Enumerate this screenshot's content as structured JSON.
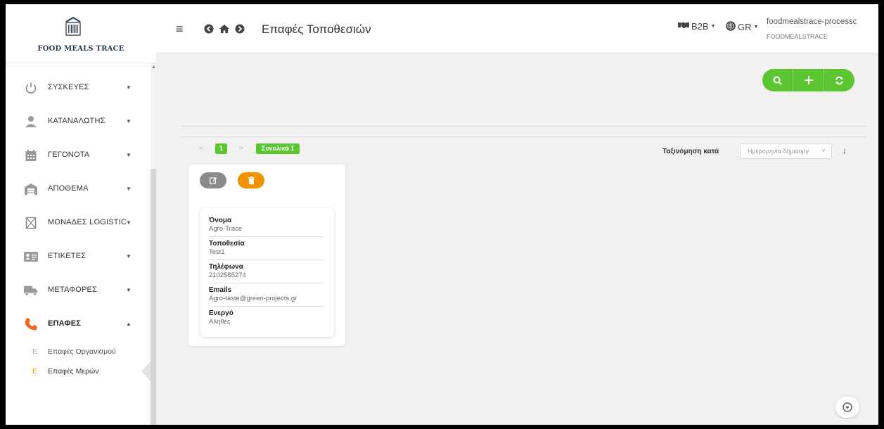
{
  "brand": {
    "name": "FOOD MEALS TRACE"
  },
  "header": {
    "page_title": "Επαφές Τοποθεσιών",
    "b2b_label": "B2B",
    "lang_label": "GR",
    "user_name": "foodmealstrace-processc",
    "user_org": "FOODMEALSTRACE"
  },
  "sidebar": {
    "items": [
      {
        "label": "ΣΥΣΚΕΥΕΣ",
        "icon": "power-icon"
      },
      {
        "label": "ΚΑΤΑΝΑΛΩΤΗΣ",
        "icon": "user-icon"
      },
      {
        "label": "ΓΕΓΟΝΟΤΑ",
        "icon": "calendar-icon"
      },
      {
        "label": "ΑΠΟΘΕΜΑ",
        "icon": "warehouse-icon"
      },
      {
        "label": "ΜΟΝΑΔΕΣ LOGISTIC",
        "icon": "box-icon"
      },
      {
        "label": "ΕΤΙΚΕΤΕΣ",
        "icon": "label-icon"
      },
      {
        "label": "ΜΕΤΑΦΟΡΕΣ",
        "icon": "truck-icon"
      },
      {
        "label": "ΕΠΑΦΕΣ",
        "icon": "phone-icon"
      }
    ],
    "subitems": [
      {
        "letter": "E",
        "label": "Επαφές Οργανισμού"
      },
      {
        "letter": "E",
        "label": "Επαφές Μερών"
      }
    ]
  },
  "pagination": {
    "current_page": "1",
    "total_label": "Συνολικά 1"
  },
  "sort": {
    "label": "Ταξινόμηση κατά",
    "selected": "Ημερομηνία δημιουργ"
  },
  "card": {
    "fields": [
      {
        "label": "Όνομα",
        "value": "Agro-Trace"
      },
      {
        "label": "Τοποθεσία",
        "value": "Test1"
      },
      {
        "label": "Τηλέφωνα",
        "value": "2102585274"
      },
      {
        "label": "Emails",
        "value": "Agro-taste@green-projects.gr"
      },
      {
        "label": "Ενεργό",
        "value": "Αληθές"
      }
    ]
  },
  "colors": {
    "accent_green": "#5cc532",
    "accent_orange": "#f39200",
    "edit_gray": "#8a8a8a",
    "phone_orange": "#f26522"
  }
}
